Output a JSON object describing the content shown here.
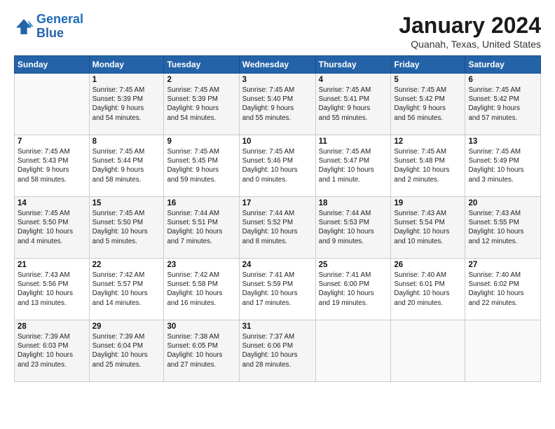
{
  "header": {
    "logo_line1": "General",
    "logo_line2": "Blue",
    "title": "January 2024",
    "subtitle": "Quanah, Texas, United States"
  },
  "days_of_week": [
    "Sunday",
    "Monday",
    "Tuesday",
    "Wednesday",
    "Thursday",
    "Friday",
    "Saturday"
  ],
  "weeks": [
    [
      {
        "day": "",
        "info": ""
      },
      {
        "day": "1",
        "info": "Sunrise: 7:45 AM\nSunset: 5:39 PM\nDaylight: 9 hours\nand 54 minutes."
      },
      {
        "day": "2",
        "info": "Sunrise: 7:45 AM\nSunset: 5:39 PM\nDaylight: 9 hours\nand 54 minutes."
      },
      {
        "day": "3",
        "info": "Sunrise: 7:45 AM\nSunset: 5:40 PM\nDaylight: 9 hours\nand 55 minutes."
      },
      {
        "day": "4",
        "info": "Sunrise: 7:45 AM\nSunset: 5:41 PM\nDaylight: 9 hours\nand 55 minutes."
      },
      {
        "day": "5",
        "info": "Sunrise: 7:45 AM\nSunset: 5:42 PM\nDaylight: 9 hours\nand 56 minutes."
      },
      {
        "day": "6",
        "info": "Sunrise: 7:45 AM\nSunset: 5:42 PM\nDaylight: 9 hours\nand 57 minutes."
      }
    ],
    [
      {
        "day": "7",
        "info": "Sunrise: 7:45 AM\nSunset: 5:43 PM\nDaylight: 9 hours\nand 58 minutes."
      },
      {
        "day": "8",
        "info": "Sunrise: 7:45 AM\nSunset: 5:44 PM\nDaylight: 9 hours\nand 58 minutes."
      },
      {
        "day": "9",
        "info": "Sunrise: 7:45 AM\nSunset: 5:45 PM\nDaylight: 9 hours\nand 59 minutes."
      },
      {
        "day": "10",
        "info": "Sunrise: 7:45 AM\nSunset: 5:46 PM\nDaylight: 10 hours\nand 0 minutes."
      },
      {
        "day": "11",
        "info": "Sunrise: 7:45 AM\nSunset: 5:47 PM\nDaylight: 10 hours\nand 1 minute."
      },
      {
        "day": "12",
        "info": "Sunrise: 7:45 AM\nSunset: 5:48 PM\nDaylight: 10 hours\nand 2 minutes."
      },
      {
        "day": "13",
        "info": "Sunrise: 7:45 AM\nSunset: 5:49 PM\nDaylight: 10 hours\nand 3 minutes."
      }
    ],
    [
      {
        "day": "14",
        "info": "Sunrise: 7:45 AM\nSunset: 5:50 PM\nDaylight: 10 hours\nand 4 minutes."
      },
      {
        "day": "15",
        "info": "Sunrise: 7:45 AM\nSunset: 5:50 PM\nDaylight: 10 hours\nand 5 minutes."
      },
      {
        "day": "16",
        "info": "Sunrise: 7:44 AM\nSunset: 5:51 PM\nDaylight: 10 hours\nand 7 minutes."
      },
      {
        "day": "17",
        "info": "Sunrise: 7:44 AM\nSunset: 5:52 PM\nDaylight: 10 hours\nand 8 minutes."
      },
      {
        "day": "18",
        "info": "Sunrise: 7:44 AM\nSunset: 5:53 PM\nDaylight: 10 hours\nand 9 minutes."
      },
      {
        "day": "19",
        "info": "Sunrise: 7:43 AM\nSunset: 5:54 PM\nDaylight: 10 hours\nand 10 minutes."
      },
      {
        "day": "20",
        "info": "Sunrise: 7:43 AM\nSunset: 5:55 PM\nDaylight: 10 hours\nand 12 minutes."
      }
    ],
    [
      {
        "day": "21",
        "info": "Sunrise: 7:43 AM\nSunset: 5:56 PM\nDaylight: 10 hours\nand 13 minutes."
      },
      {
        "day": "22",
        "info": "Sunrise: 7:42 AM\nSunset: 5:57 PM\nDaylight: 10 hours\nand 14 minutes."
      },
      {
        "day": "23",
        "info": "Sunrise: 7:42 AM\nSunset: 5:58 PM\nDaylight: 10 hours\nand 16 minutes."
      },
      {
        "day": "24",
        "info": "Sunrise: 7:41 AM\nSunset: 5:59 PM\nDaylight: 10 hours\nand 17 minutes."
      },
      {
        "day": "25",
        "info": "Sunrise: 7:41 AM\nSunset: 6:00 PM\nDaylight: 10 hours\nand 19 minutes."
      },
      {
        "day": "26",
        "info": "Sunrise: 7:40 AM\nSunset: 6:01 PM\nDaylight: 10 hours\nand 20 minutes."
      },
      {
        "day": "27",
        "info": "Sunrise: 7:40 AM\nSunset: 6:02 PM\nDaylight: 10 hours\nand 22 minutes."
      }
    ],
    [
      {
        "day": "28",
        "info": "Sunrise: 7:39 AM\nSunset: 6:03 PM\nDaylight: 10 hours\nand 23 minutes."
      },
      {
        "day": "29",
        "info": "Sunrise: 7:39 AM\nSunset: 6:04 PM\nDaylight: 10 hours\nand 25 minutes."
      },
      {
        "day": "30",
        "info": "Sunrise: 7:38 AM\nSunset: 6:05 PM\nDaylight: 10 hours\nand 27 minutes."
      },
      {
        "day": "31",
        "info": "Sunrise: 7:37 AM\nSunset: 6:06 PM\nDaylight: 10 hours\nand 28 minutes."
      },
      {
        "day": "",
        "info": ""
      },
      {
        "day": "",
        "info": ""
      },
      {
        "day": "",
        "info": ""
      }
    ]
  ]
}
